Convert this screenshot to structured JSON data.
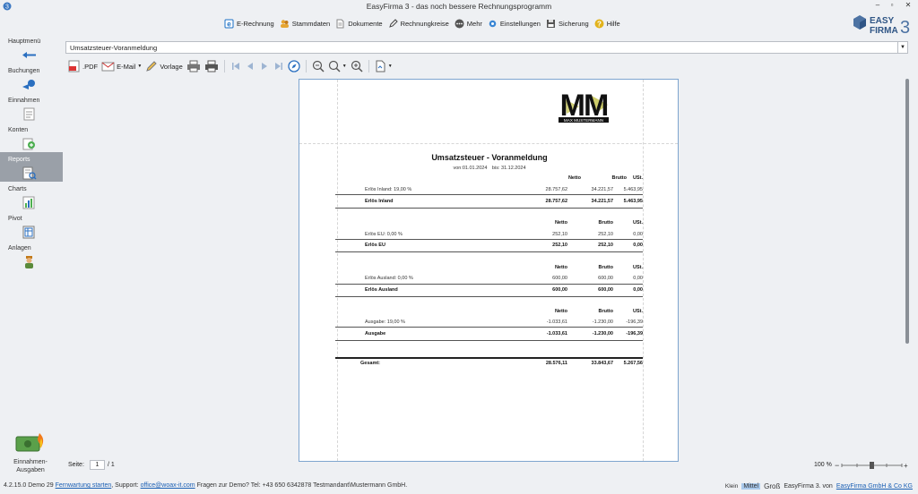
{
  "window": {
    "title": "EasyFirma 3 - das noch bessere Rechnungsprogramm",
    "minimize": "–",
    "restore": "▫",
    "close": "✕"
  },
  "brand": {
    "line1": "EASY",
    "line2": "FIRMA",
    "version": "3"
  },
  "menu": [
    {
      "label": "E-Rechnung",
      "icon": "e-invoice-icon",
      "color": "#1a6fc4"
    },
    {
      "label": "Stammdaten",
      "icon": "people-icon",
      "color": "#e6a532"
    },
    {
      "label": "Dokumente",
      "icon": "document-icon",
      "color": "#9aa5b1"
    },
    {
      "label": "Rechnungkreise",
      "icon": "pencil-icon",
      "color": "#4a4a4a"
    },
    {
      "label": "Mehr",
      "icon": "more-icon",
      "color": "#555"
    },
    {
      "label": "Einstellungen",
      "icon": "settings-icon",
      "color": "#3a86d4"
    },
    {
      "label": "Sicherung",
      "icon": "backup-icon",
      "color": "#555"
    },
    {
      "label": "Hilfe",
      "icon": "help-icon",
      "color": "#e2b31c"
    }
  ],
  "sidebar": {
    "items": [
      {
        "label": "Hauptmenü",
        "icon": "back-arrow-icon"
      },
      {
        "label": "Buchungen",
        "icon": "bookings-icon"
      },
      {
        "label": "Einnahmen",
        "icon": "income-icon"
      },
      {
        "label": "Konten",
        "icon": "accounts-icon"
      },
      {
        "label": "Reports",
        "icon": "reports-icon",
        "active": true
      },
      {
        "label": "Charts",
        "icon": "charts-icon"
      },
      {
        "label": "Pivot",
        "icon": "pivot-icon"
      },
      {
        "label": "Anlagen",
        "icon": "assets-icon"
      }
    ],
    "bottom": {
      "line1": "Einnahmen-",
      "line2": "Ausgaben",
      "icon": "income-expense-icon"
    }
  },
  "report_selector": {
    "value": "Umsatzsteuer-Voranmeldung"
  },
  "toolbar": {
    "pdf": ".PDF",
    "email": "E-Mail",
    "vorlage": "Vorlage"
  },
  "report": {
    "logo_big": "MM",
    "logo_text": "MAX MUSTERMANN",
    "title": "Umsatzsteuer - Voranmeldung",
    "period_from": "von:01.01.2024",
    "period_to": "bis: 31.12.2024",
    "col_netto": "Netto",
    "col_brutto": "Brutto",
    "col_ust": "USt.",
    "sections": [
      {
        "row_label": "Erlös Inland: 19,00 %",
        "netto": "28.757,62",
        "brutto": "34.221,57",
        "ust": "5.463,95",
        "sum_label": "Erlös Inland",
        "sum_netto": "28.757,62",
        "sum_brutto": "34.221,57",
        "sum_ust": "5.463,95"
      },
      {
        "row_label": "Erlös EU: 0,00 %",
        "netto": "252,10",
        "brutto": "252,10",
        "ust": "0,00",
        "sum_label": "Erlös EU",
        "sum_netto": "252,10",
        "sum_brutto": "252,10",
        "sum_ust": "0,00"
      },
      {
        "row_label": "Erlös Ausland: 0,00 %",
        "netto": "600,00",
        "brutto": "600,00",
        "ust": "0,00",
        "sum_label": "Erlös Ausland",
        "sum_netto": "600,00",
        "sum_brutto": "600,00",
        "sum_ust": "0,00"
      },
      {
        "row_label": "Ausgabe: 19,00 %",
        "netto": "-1.033,61",
        "brutto": "-1.230,00",
        "ust": "-196,39",
        "sum_label": "Ausgabe",
        "sum_netto": "-1.033,61",
        "sum_brutto": "-1.230,00",
        "sum_ust": "-196,39"
      }
    ],
    "total_label": "Gesamt:",
    "total_netto": "28.576,11",
    "total_brutto": "33.843,67",
    "total_ust": "5.267,56"
  },
  "pager": {
    "label": "Seite:",
    "current": "1",
    "total": "/ 1",
    "zoom": "100 %"
  },
  "status": {
    "version": "4.2.15.0 Demo 29",
    "maintenance_link": "Fernwartung starten",
    "support_prefix": ", Support:",
    "support_email": "office@woax-it.com",
    "demo_text": "Fragen zur Demo? Tel: +43 650 6342878 Testmandant\\Mustermann GmbH.",
    "size_small": "Klein",
    "size_medium": "Mittel",
    "size_large": "Groß",
    "footer_prefix": "EasyFirma 3. von",
    "footer_link": "EasyFirma GmbH & Co KG"
  }
}
